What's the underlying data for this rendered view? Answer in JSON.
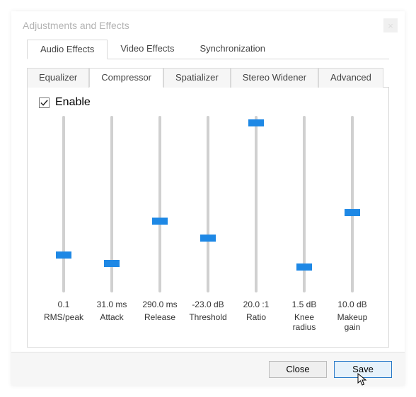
{
  "window": {
    "title": "Adjustments and Effects",
    "close": "×"
  },
  "tabs": {
    "main": [
      "Audio Effects",
      "Video Effects",
      "Synchronization"
    ],
    "main_active": 0,
    "sub": [
      "Equalizer",
      "Compressor",
      "Spatializer",
      "Stereo Widener",
      "Advanced"
    ],
    "sub_active": 1
  },
  "enable": {
    "label": "Enable",
    "checked": true
  },
  "sliders": [
    {
      "value": "0.1",
      "label": "RMS/peak",
      "pos_pct": 80
    },
    {
      "value": "31.0 ms",
      "label": "Attack",
      "pos_pct": 85
    },
    {
      "value": "290.0 ms",
      "label": "Release",
      "pos_pct": 60
    },
    {
      "value": "-23.0 dB",
      "label": "Threshold",
      "pos_pct": 70
    },
    {
      "value": "20.0 :1",
      "label": "Ratio",
      "pos_pct": 2
    },
    {
      "value": "1.5 dB",
      "label": "Knee radius",
      "pos_pct": 87
    },
    {
      "value": "10.0 dB",
      "label": "Makeup gain",
      "pos_pct": 55
    }
  ],
  "footer": {
    "close": "Close",
    "save": "Save"
  }
}
